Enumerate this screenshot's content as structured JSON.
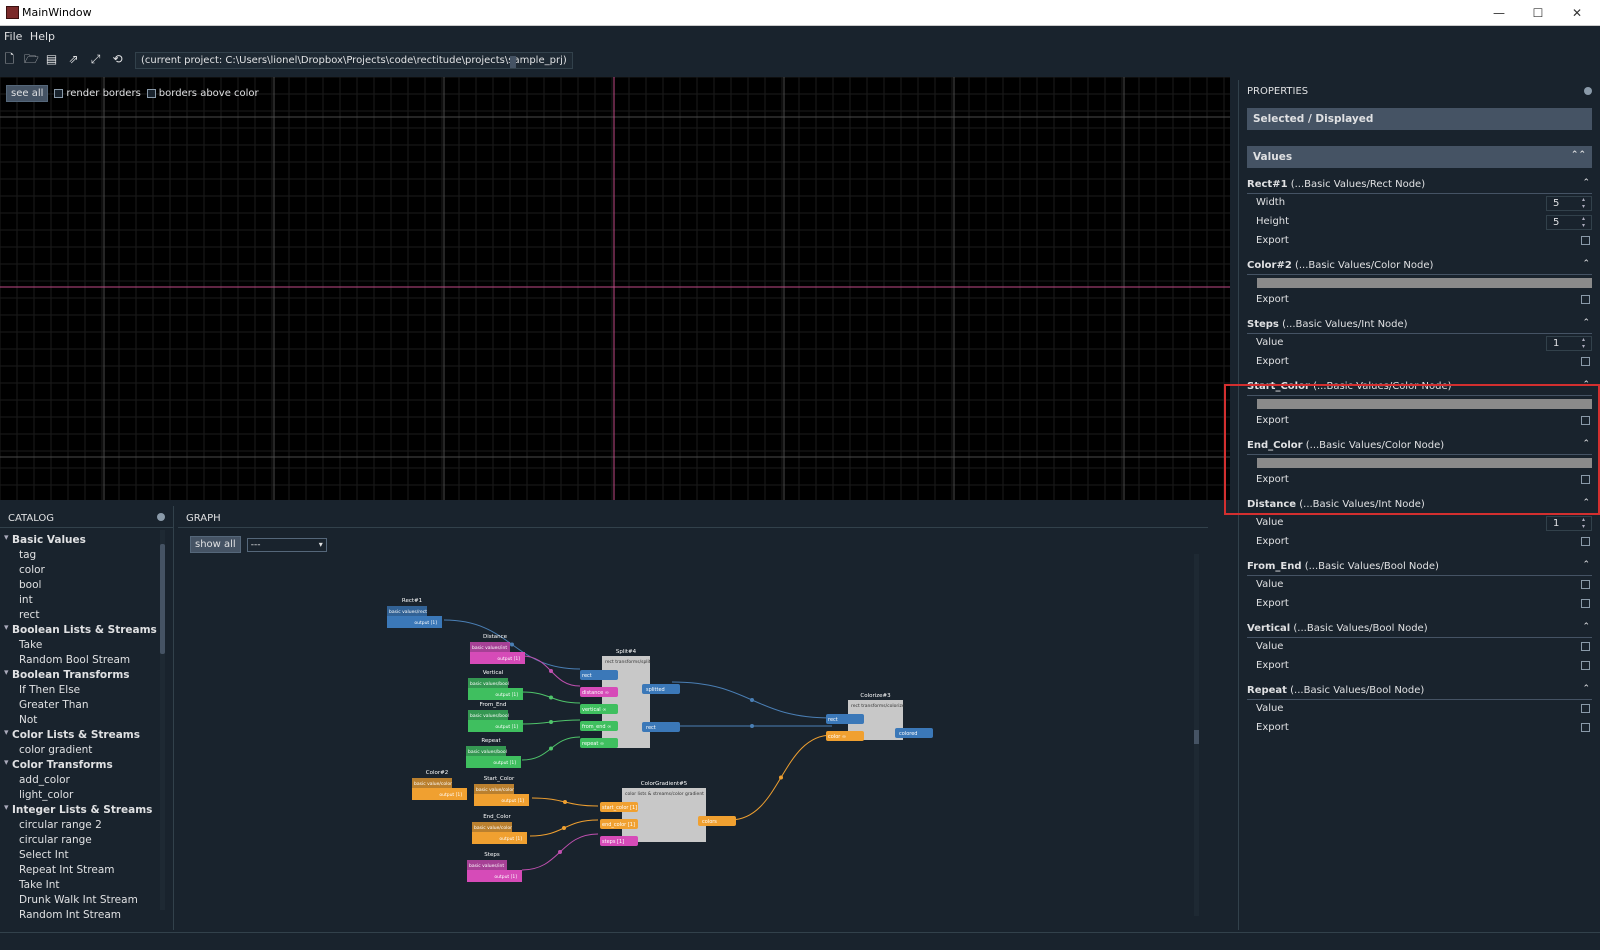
{
  "window": {
    "title": "MainWindow",
    "minimize": "—",
    "maximize": "☐",
    "close": "✕"
  },
  "menu": {
    "file": "File",
    "help": "Help"
  },
  "toolbar": {
    "project_path": "(current project: C:\\Users\\lionel\\Dropbox\\Projects\\code\\rectitude\\projects\\sample_prj)"
  },
  "viewport": {
    "see_all": "see all",
    "render_borders": "render borders",
    "borders_above_color": "borders above color",
    "grid_color": "#1b1b1b",
    "major_grid_color": "#4a4a4a",
    "axis_color": "#c04a86"
  },
  "catalog": {
    "title": "CATALOG",
    "groups": [
      {
        "name": "Basic Values",
        "items": [
          "tag",
          "color",
          "bool",
          "int",
          "rect"
        ]
      },
      {
        "name": "Boolean Lists & Streams",
        "items": [
          "Take",
          "Random Bool Stream"
        ]
      },
      {
        "name": "Boolean Transforms",
        "items": [
          "If Then Else",
          "Greater Than",
          "Not"
        ]
      },
      {
        "name": "Color Lists & Streams",
        "items": [
          "color gradient"
        ]
      },
      {
        "name": "Color Transforms",
        "items": [
          "add_color",
          "light_color"
        ]
      },
      {
        "name": "Integer Lists & Streams",
        "items": [
          "circular range 2",
          "circular range",
          "Select Int",
          "Repeat Int Stream",
          "Take Int",
          "Drunk Walk Int Stream",
          "Random Int Stream"
        ]
      }
    ]
  },
  "graph": {
    "title": "GRAPH",
    "show_all": "show all",
    "combo_value": "---",
    "colors": {
      "blue": "#3b78b8",
      "pink": "#d64bb8",
      "green": "#3fbf5f",
      "orange": "#f0a030",
      "gray": "#c8c8c8",
      "wire_blue": "#4a7fb5",
      "wire_green": "#4fc46a",
      "wire_orange": "#f0a030",
      "wire_pink": "#c050b0"
    },
    "nodes": [
      {
        "id": "rect1",
        "title": "Rect#1",
        "type": "basic values/rect",
        "color": "blue",
        "port": "output [1]"
      },
      {
        "id": "distance",
        "title": "Distance",
        "type": "basic values/int",
        "color": "pink",
        "port": "output [1]"
      },
      {
        "id": "vertical",
        "title": "Vertical",
        "type": "basic values/bool",
        "color": "green",
        "port": "output [1]"
      },
      {
        "id": "fromend",
        "title": "From_End",
        "type": "basic values/bool",
        "color": "green",
        "port": "output [1]"
      },
      {
        "id": "repeat",
        "title": "Repeat",
        "type": "basic values/bool",
        "color": "green",
        "port": "output [1]"
      },
      {
        "id": "color2",
        "title": "Color#2",
        "type": "basic value/color",
        "color": "orange",
        "port": "output [1]"
      },
      {
        "id": "startcolor",
        "title": "Start_Color",
        "type": "basic value/color",
        "color": "orange",
        "port": "output [1]"
      },
      {
        "id": "endcolor",
        "title": "End_Color",
        "type": "basic value/color",
        "color": "orange",
        "port": "output [1]"
      },
      {
        "id": "steps",
        "title": "Steps",
        "type": "basic values/int",
        "color": "pink",
        "port": "output [1]"
      },
      {
        "id": "split4",
        "title": "Split#4",
        "type": "rect transforms/split",
        "inputs": [
          "rect",
          "distance ∞",
          "vertical ∞",
          "from_end ∞",
          "repeat ∞"
        ],
        "outputs": [
          "splitted",
          "rect"
        ]
      },
      {
        "id": "colorize3",
        "title": "Colorize#3",
        "type": "rect transforms/colorize",
        "inputs": [
          "rect",
          "color ∞"
        ],
        "outputs": [
          "colored"
        ]
      },
      {
        "id": "gradient5",
        "title": "ColorGradient#5",
        "type": "color lists & streams/color gradient",
        "inputs": [
          "start_color [1]",
          "end_color [1]",
          "steps [1]"
        ],
        "outputs": [
          "colors"
        ]
      }
    ]
  },
  "properties": {
    "title": "PROPERTIES",
    "selected": "Selected / Displayed",
    "values": "Values",
    "nodes": [
      {
        "name": "Rect#1",
        "path": "(...Basic Values/Rect Node)",
        "rows": [
          {
            "label": "Width",
            "kind": "spin",
            "value": "5"
          },
          {
            "label": "Height",
            "kind": "spin",
            "value": "5"
          },
          {
            "label": "Export",
            "kind": "check"
          }
        ]
      },
      {
        "name": "Color#2",
        "path": "(...Basic Values/Color Node)",
        "rows": [
          {
            "kind": "color"
          },
          {
            "label": "Export",
            "kind": "check"
          }
        ]
      },
      {
        "name": "Steps",
        "path": "(...Basic Values/Int Node)",
        "rows": [
          {
            "label": "Value",
            "kind": "spin",
            "value": "1"
          },
          {
            "label": "Export",
            "kind": "check"
          }
        ]
      },
      {
        "name": "Start_Color",
        "path": "(...Basic Values/Color Node)",
        "rows": [
          {
            "kind": "color"
          },
          {
            "label": "Export",
            "kind": "check"
          }
        ]
      },
      {
        "name": "End_Color",
        "path": "(...Basic Values/Color Node)",
        "rows": [
          {
            "kind": "color"
          },
          {
            "label": "Export",
            "kind": "check"
          }
        ]
      },
      {
        "name": "Distance",
        "path": "(...Basic Values/Int Node)",
        "rows": [
          {
            "label": "Value",
            "kind": "spin",
            "value": "1"
          },
          {
            "label": "Export",
            "kind": "check"
          }
        ]
      },
      {
        "name": "From_End",
        "path": "(...Basic Values/Bool Node)",
        "rows": [
          {
            "label": "Value",
            "kind": "check"
          },
          {
            "label": "Export",
            "kind": "check"
          }
        ]
      },
      {
        "name": "Vertical",
        "path": "(...Basic Values/Bool Node)",
        "rows": [
          {
            "label": "Value",
            "kind": "check"
          },
          {
            "label": "Export",
            "kind": "check"
          }
        ]
      },
      {
        "name": "Repeat",
        "path": "(...Basic Values/Bool Node)",
        "rows": [
          {
            "label": "Value",
            "kind": "check"
          },
          {
            "label": "Export",
            "kind": "check"
          }
        ]
      }
    ]
  }
}
